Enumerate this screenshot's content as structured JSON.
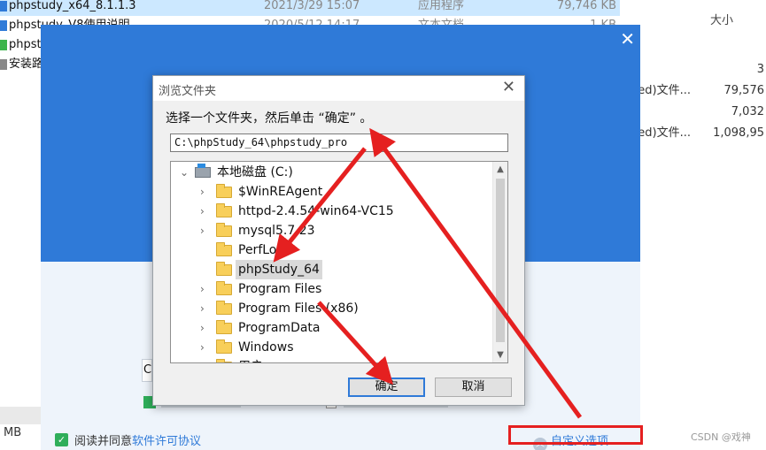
{
  "explorer": {
    "files": [
      {
        "name": "phpstudy_x64_8.1.1.3",
        "date": "2021/3/29 15:07",
        "type": "应用程序",
        "size": "79,746 KB",
        "selected": true,
        "icon_color": "#2f7ad8"
      },
      {
        "name": "phpstudy_V8使用说明",
        "date": "2020/5/12 14:17",
        "type": "文本文档",
        "size": "1 KB",
        "selected": false,
        "icon_color": "#2f7ad8"
      },
      {
        "name": "phpst",
        "date": "",
        "type": "",
        "size": "",
        "selected": false,
        "icon_color": "#3cb44b"
      },
      {
        "name": "安装路",
        "date": "",
        "type": "",
        "size": "",
        "selected": false,
        "icon_color": "#888888"
      }
    ],
    "right_pane": {
      "header": "大小",
      "rows": [
        {
          "type": "",
          "size": "3"
        },
        {
          "type": "ped)文件...",
          "size": "79,576"
        },
        {
          "type": "",
          "size": "7,032"
        },
        {
          "type": "ped)文件...",
          "size": "1,098,95"
        }
      ]
    },
    "status_unit": "MB"
  },
  "installer": {
    "close_glyph": "✕",
    "path_stub": "C",
    "agree_label": "阅读并同意",
    "agree_link": "软件许可协议",
    "custom_options": "自定义选项",
    "accent_color": "#2f7ad8"
  },
  "dialog": {
    "title": "浏览文件夹",
    "instruction": "选择一个文件夹，然后单击 “确定” 。",
    "path_value": "C:\\phpStudy_64\\phpstudy_pro",
    "tree": {
      "root": {
        "label": "本地磁盘 (C:)",
        "expanded": true
      },
      "items": [
        {
          "label": "$WinREAgent",
          "expandable": true,
          "selected": false
        },
        {
          "label": "httpd-2.4.54-win64-VC15",
          "expandable": true,
          "selected": false
        },
        {
          "label": "mysql5.7.23",
          "expandable": true,
          "selected": false
        },
        {
          "label": "PerfLogs",
          "expandable": false,
          "selected": false
        },
        {
          "label": "phpStudy_64",
          "expandable": false,
          "selected": true
        },
        {
          "label": "Program Files",
          "expandable": true,
          "selected": false
        },
        {
          "label": "Program Files (x86)",
          "expandable": true,
          "selected": false
        },
        {
          "label": "ProgramData",
          "expandable": true,
          "selected": false
        },
        {
          "label": "Windows",
          "expandable": true,
          "selected": false
        },
        {
          "label": "用户",
          "expandable": true,
          "selected": false
        }
      ]
    },
    "ok_label": "确定",
    "cancel_label": "取消"
  },
  "annotation_color": "#e52020",
  "watermark": "CSDN @戏神"
}
